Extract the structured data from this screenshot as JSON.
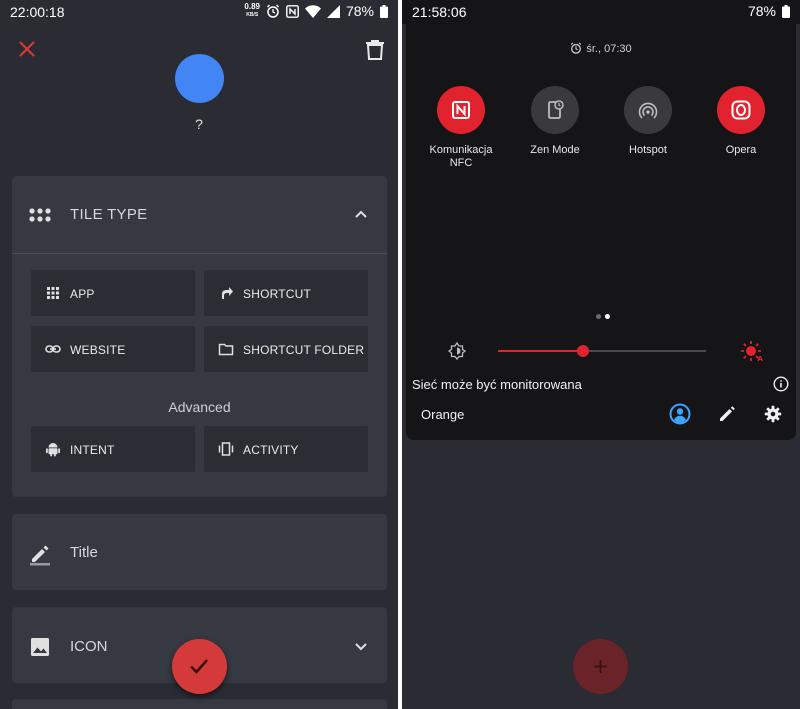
{
  "left": {
    "status": {
      "time": "22:00:18",
      "speed_value": "0.89",
      "speed_unit": "KB/S",
      "battery": "78%"
    },
    "avatar_label": "?",
    "tile_type": {
      "header": "TILE TYPE",
      "options": [
        "APP",
        "SHORTCUT",
        "WEBSITE",
        "SHORTCUT FOLDER"
      ],
      "advanced_label": "Advanced",
      "advanced_options": [
        "INTENT",
        "ACTIVITY"
      ]
    },
    "title_card": {
      "label": "Title"
    },
    "icon_card": {
      "label": "ICON"
    }
  },
  "right": {
    "status": {
      "time": "21:58:06",
      "battery": "78%"
    },
    "alarm_text": "śr., 07:30",
    "tiles": [
      {
        "line1": "Komunikacja",
        "line2": "NFC",
        "state": "on",
        "icon": "nfc-icon"
      },
      {
        "line1": "Zen Mode",
        "line2": "",
        "state": "off",
        "icon": "zen-mode-icon"
      },
      {
        "line1": "Hotspot",
        "line2": "",
        "state": "off",
        "icon": "hotspot-icon"
      },
      {
        "line1": "Opera",
        "line2": "",
        "state": "on",
        "icon": "opera-icon"
      }
    ],
    "page_index": 2,
    "page_count": 2,
    "brightness_level": 0.41,
    "network_notice": "Sieć może być monitorowana",
    "carrier": "Orange"
  },
  "colors": {
    "accent_red": "#e0232e",
    "fab_red": "#d53a3b",
    "avatar_blue": "#4285f4",
    "user_blue": "#3ea6ff"
  }
}
